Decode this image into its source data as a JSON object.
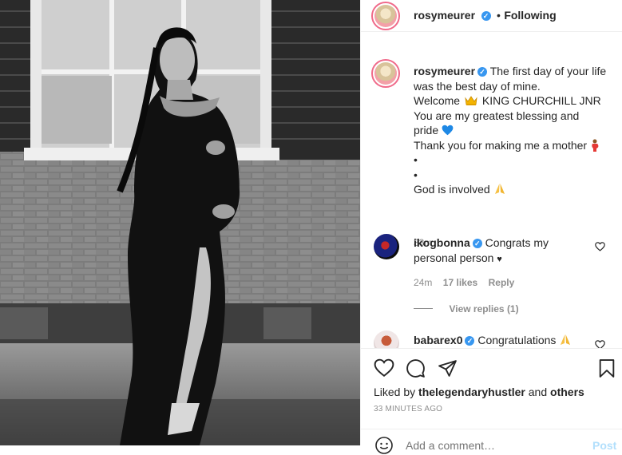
{
  "header": {
    "username": "rosymeurer",
    "separator": "•",
    "follow_status": "Following"
  },
  "caption": {
    "username": "rosymeurer",
    "lines": [
      "The first day of your life",
      "was the best day of mine.",
      "Welcome",
      "KING CHURCHILL JNR",
      "You are my greatest blessing and",
      "pride",
      "Thank you for making me a mother",
      "•",
      "•",
      "God is involved"
    ],
    "time": "33m"
  },
  "comments": [
    {
      "username": "ikogbonna",
      "text_line1": "Congrats my",
      "text_line2": "personal person",
      "heart_glyph": "♥",
      "time": "24m",
      "likes": "17 likes",
      "reply_label": "Reply",
      "view_replies": "View replies (1)"
    },
    {
      "username": "babarex0",
      "text": "Congratulations"
    }
  ],
  "footer": {
    "liked_by_prefix": "Liked by",
    "liked_by_user": "thelegendaryhustler",
    "liked_by_and": "and",
    "liked_by_others": "others",
    "timestamp": "33 MINUTES AGO",
    "comment_placeholder": "Add a comment…",
    "post_label": "Post"
  },
  "icons": {
    "like": "heart-icon",
    "comment": "comment-icon",
    "share": "share-icon",
    "save": "bookmark-icon",
    "emoji": "emoji-icon",
    "crown": "crown-emoji",
    "blue_heart": "blue-heart-emoji",
    "pray": "pray-emoji",
    "pregnant": "pregnant-emoji"
  },
  "colors": {
    "verified": "#3897f0",
    "link_blue": "#0095f6",
    "muted": "#8e8e8e",
    "text": "#262626"
  }
}
